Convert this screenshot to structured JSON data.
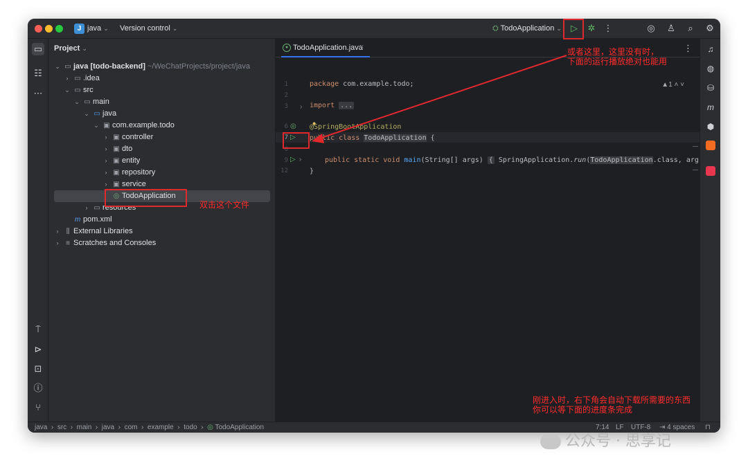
{
  "titlebar": {
    "project_badge": "J",
    "project_name": "java",
    "version_control": "Version control",
    "run_config": "TodoApplication",
    "icons": [
      "run-icon",
      "debug-icon",
      "more-icon",
      "ai-assistant-icon",
      "add-user-icon",
      "search-icon",
      "settings-icon"
    ]
  },
  "project_panel": {
    "header": "Project",
    "tree": [
      {
        "label": "java [todo-backend]",
        "suffix": "~/WeChatProjects/project/java",
        "icon": "folder-icon"
      },
      {
        "label": ".idea",
        "icon": "folder-icon"
      },
      {
        "label": "src",
        "icon": "folder-icon"
      },
      {
        "label": "main",
        "icon": "folder-icon"
      },
      {
        "label": "java",
        "icon": "source-folder-icon"
      },
      {
        "label": "com.example.todo",
        "icon": "package-icon"
      },
      {
        "label": "controller",
        "icon": "package-icon"
      },
      {
        "label": "dto",
        "icon": "package-icon"
      },
      {
        "label": "entity",
        "icon": "package-icon"
      },
      {
        "label": "repository",
        "icon": "package-icon"
      },
      {
        "label": "service",
        "icon": "package-icon"
      },
      {
        "label": "TodoApplication",
        "icon": "spring-class-icon"
      },
      {
        "label": "resources",
        "icon": "resources-folder-icon"
      },
      {
        "label": "pom.xml",
        "icon": "maven-icon"
      },
      {
        "label": "External Libraries",
        "icon": "library-icon"
      },
      {
        "label": "Scratches and Consoles",
        "icon": "scratches-icon"
      }
    ]
  },
  "editor": {
    "tab_label": "TodoApplication.java",
    "line_numbers": [
      "1",
      "2",
      "3",
      "6",
      "7",
      "8",
      "9",
      "12"
    ],
    "code": {
      "line1_kw": "package",
      "line1_rest": " com.example.todo;",
      "line3_kw": "import",
      "line3_fold": "...",
      "line6_annotation": "@SpringBootApplication",
      "line7_kw": "public class",
      "line7_name": "TodoApplication",
      "line7_rest": " {",
      "line9_kw": "public static void",
      "line9_fn": "main",
      "line9_params": "(String[] args)",
      "line9_open": "{",
      "line9_body": " SpringApplication.",
      "line9_run": "run",
      "line9_arg": "TodoApplication",
      "line9_tail": ".class, args);",
      "line9_close": "}",
      "line12": "}"
    },
    "inspection_count": "1"
  },
  "statusbar": {
    "breadcrumb": [
      "java",
      "src",
      "main",
      "java",
      "com",
      "example",
      "todo",
      "TodoApplication"
    ],
    "position": "7:14",
    "line_separator": "LF",
    "encoding": "UTF-8",
    "indent": "4 spaces"
  },
  "annotations": {
    "note_run_top": "或者这里，这里没有时，\n下面的运行播放绝对也能用",
    "note_double_click": "双击这个文件",
    "note_bottom": "刚进入时，右下角会自动下载所需要的东西\n你可以等下面的进度条完成"
  },
  "watermark": "公众号 · 思享记"
}
